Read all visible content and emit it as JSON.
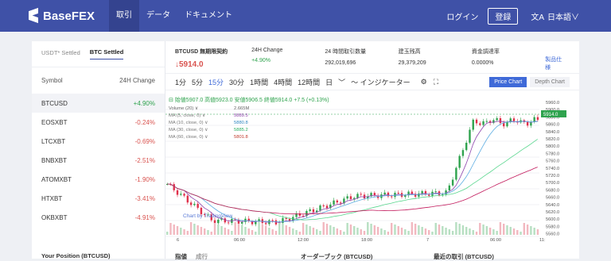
{
  "header": {
    "brand": "BaseFEX",
    "nav": [
      "取引",
      "データ",
      "ドキュメント"
    ],
    "login": "ログイン",
    "register": "登録",
    "lang": "日本語∨",
    "lang_icon": "文A"
  },
  "sidebar": {
    "tabs": [
      "USDT* Settled",
      "BTC Settled"
    ],
    "col_symbol": "Symbol",
    "col_change": "24H Change",
    "items": [
      {
        "symbol": "BTCUSD",
        "change": "+4.90%",
        "dir": "up"
      },
      {
        "symbol": "EOSXBT",
        "change": "-0.24%",
        "dir": "down"
      },
      {
        "symbol": "LTCXBT",
        "change": "-0.69%",
        "dir": "down"
      },
      {
        "symbol": "BNBXBT",
        "change": "-2.51%",
        "dir": "down"
      },
      {
        "symbol": "ATOMXBT",
        "change": "-1.90%",
        "dir": "down"
      },
      {
        "symbol": "HTXBT",
        "change": "-3.41%",
        "dir": "down"
      },
      {
        "symbol": "OKBXBT",
        "change": "-4.91%",
        "dir": "down"
      }
    ]
  },
  "ticker": {
    "title": "BTCUSD 無期限契約",
    "price": "↓5914.0",
    "change_label": "24H Change",
    "change": "+4.90%",
    "volume_label": "24 時間取引数量",
    "volume": "292,019,696",
    "oi_label": "建玉残高",
    "oi": "29,379,209",
    "funding_label": "資金調達率",
    "funding": "0.0000%",
    "rules": "製品仕様"
  },
  "toolbar": {
    "timeframes": [
      "1分",
      "5分",
      "15分",
      "30分",
      "1時間",
      "4時間",
      "12時間"
    ],
    "day": "日",
    "chevron": "﹀",
    "indicator": "〜 インジケーター",
    "price_chart": "Price Chart",
    "depth_chart": "Depth Chart",
    "gear_icon": "⚙",
    "expand_icon": "⛶"
  },
  "legend": {
    "ohlc": "⊟ 始値5907.0 高値5923.0 安値5906.5 終値5914.0 +7.5 (+0.13%)",
    "volume": "Volume (20) ∨",
    "volume_val": "2.665M",
    "mas": [
      {
        "label": "MA (5, close, 0) ∨",
        "val": "5889.5",
        "color": "#8e44ad"
      },
      {
        "label": "MA (10, close, 0) ∨",
        "val": "5880.8",
        "color": "#2e86c1"
      },
      {
        "label": "MA (30, close, 0) ∨",
        "val": "5885.2",
        "color": "#27ae60"
      },
      {
        "label": "MA (60, close, 0) ∨",
        "val": "5801.8",
        "color": "#c0392b"
      }
    ],
    "watermark": "Chart by TradingView"
  },
  "chart_data": {
    "type": "line",
    "title": "",
    "yticks": [
      "5960.0",
      "5900.0",
      "5880.0",
      "5860.0",
      "5840.0",
      "5820.0",
      "5800.0",
      "5780.0",
      "5760.0",
      "5740.0",
      "5720.0",
      "5700.0",
      "5680.0",
      "5660.0",
      "5640.0",
      "5620.0",
      "5600.0",
      "5580.0",
      "5560.0"
    ],
    "xticks": [
      "6",
      "06:00",
      "12:00",
      "18:00",
      "7",
      "06:00",
      "11:"
    ],
    "last_price_tag": "5914.0",
    "colors": {
      "up": "#2fa34e",
      "down": "#e0304b",
      "ma5": "#8e44ad",
      "ma10": "#5dade2",
      "ma30": "#58d68d",
      "ma60": "#c2185b"
    }
  },
  "bottom": {
    "position": "Your Position (BTCUSD)",
    "orders": "指値",
    "orders2": "成行",
    "book": "オーダーブック (BTCUSD)",
    "trades": "最近の取引 (BTCUSD)"
  }
}
